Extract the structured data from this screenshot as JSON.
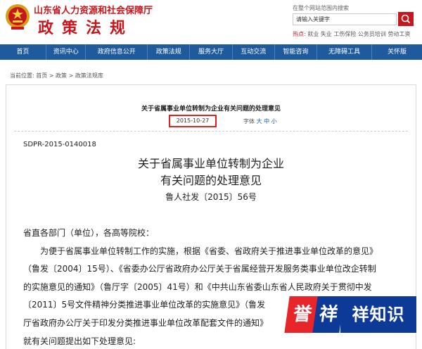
{
  "header": {
    "site_name": "山东省人力资源和社会保障厅",
    "site_title": "政策法规",
    "search_hint": "在整个网站范围内搜索",
    "search_placeholder": "请输入关键字",
    "hot_label": "热点:",
    "hot_terms": "就业 失业 工伤保险 公务员培训 劳动工资"
  },
  "nav": {
    "items": [
      "首页",
      "资讯中心",
      "政府信息公开",
      "政策法规",
      "服务大厅",
      "互动交流",
      "智能咨询",
      "无障碍工具",
      "关怀版"
    ]
  },
  "breadcrumb": "当前位置: 首页 > 政策 > 政策法规库",
  "article": {
    "header_title": "关于省属事业单位转制为企业有关问题的处理意见",
    "date": "2015-10-27",
    "font_size_label": "字体",
    "font_sizes": [
      "大",
      "中",
      "小"
    ],
    "doc_number": "SDPR-2015-0140018",
    "title_line1": "关于省属事业单位转制为企业",
    "title_line2": "有关问题的处理意见",
    "issue_number": "鲁人社发〔2015〕56号",
    "paragraphs": [
      "省直各部门（单位），各高等院校：",
      "　　为便于省属事业单位转制工作的实施，根据《省委、省政府关于推进事业单位改革的意见》",
      "（鲁发〔2004〕15号）、《省委办公厅省政府办公厅关于省属经营开发服务类事业单位改企转制",
      "的实施意见的通知》（鲁厅字〔2005〕41号）和《中共山东省委山东省人民政府关于贯彻中发",
      "〔2011〕5号文件精神分类推进事业单位改革的实施意见》（鲁发",
      "厅省政府办公厅关于印发分类推进事业单位改革配套文件的通知》",
      "就有关问题提出如下处理意见:"
    ]
  },
  "watermark": {
    "char1": "誉",
    "char2": "祥",
    "rest": "祥知识"
  },
  "colors": {
    "brand_red": "#c8161d",
    "nav_blue": "#1f5a9c",
    "highlight_red": "#e0201e",
    "watermark_red": "#e8262a",
    "watermark_blue": "#0c3a96"
  }
}
